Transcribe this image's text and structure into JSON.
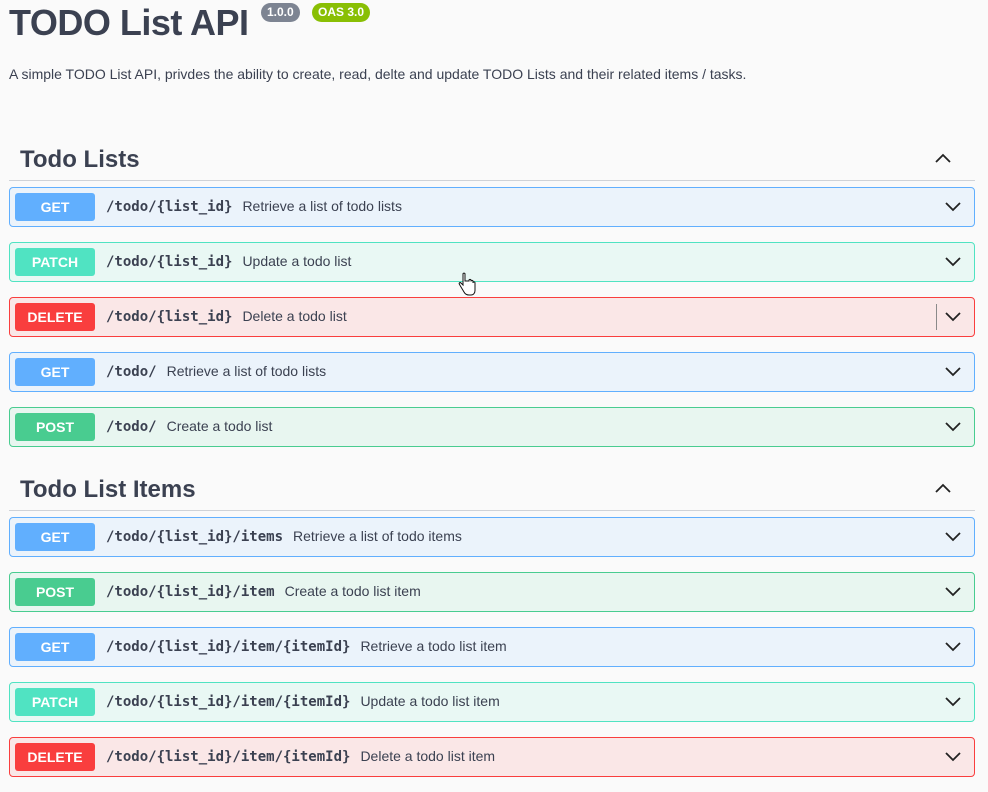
{
  "info": {
    "title": "TODO List API",
    "version_badge": "1.0.0",
    "oas_badge": "OAS 3.0",
    "description": "A simple TODO List API, privdes the ability to create, read, delte and update TODO Lists and their related items / tasks."
  },
  "sections": [
    {
      "title": "Todo Lists",
      "toggle_icon": "chevron-up-icon",
      "operations": [
        {
          "method": "GET",
          "path": "/todo/{list_id}",
          "summary": "Retrieve a list of todo lists"
        },
        {
          "method": "PATCH",
          "path": "/todo/{list_id}",
          "summary": "Update a todo list"
        },
        {
          "method": "DELETE",
          "path": "/todo/{list_id}",
          "summary": "Delete a todo list"
        },
        {
          "method": "GET",
          "path": "/todo/",
          "summary": "Retrieve a list of todo lists"
        },
        {
          "method": "POST",
          "path": "/todo/",
          "summary": "Create a todo list"
        }
      ]
    },
    {
      "title": "Todo List Items",
      "toggle_icon": "chevron-up-icon",
      "operations": [
        {
          "method": "GET",
          "path": "/todo/{list_id}/items",
          "summary": "Retrieve a list of todo items"
        },
        {
          "method": "POST",
          "path": "/todo/{list_id}/item",
          "summary": "Create a todo list item"
        },
        {
          "method": "GET",
          "path": "/todo/{list_id}/item/{itemId}",
          "summary": "Retrieve a todo list item"
        },
        {
          "method": "PATCH",
          "path": "/todo/{list_id}/item/{itemId}",
          "summary": "Update a todo list item"
        },
        {
          "method": "DELETE",
          "path": "/todo/{list_id}/item/{itemId}",
          "summary": "Delete a todo list item"
        }
      ]
    }
  ],
  "colors": {
    "get": "#61affe",
    "patch": "#50e3c2",
    "post": "#49cc90",
    "delete": "#f93e3e",
    "version_badge": "#7d8492",
    "oas_badge": "#89bf04"
  }
}
